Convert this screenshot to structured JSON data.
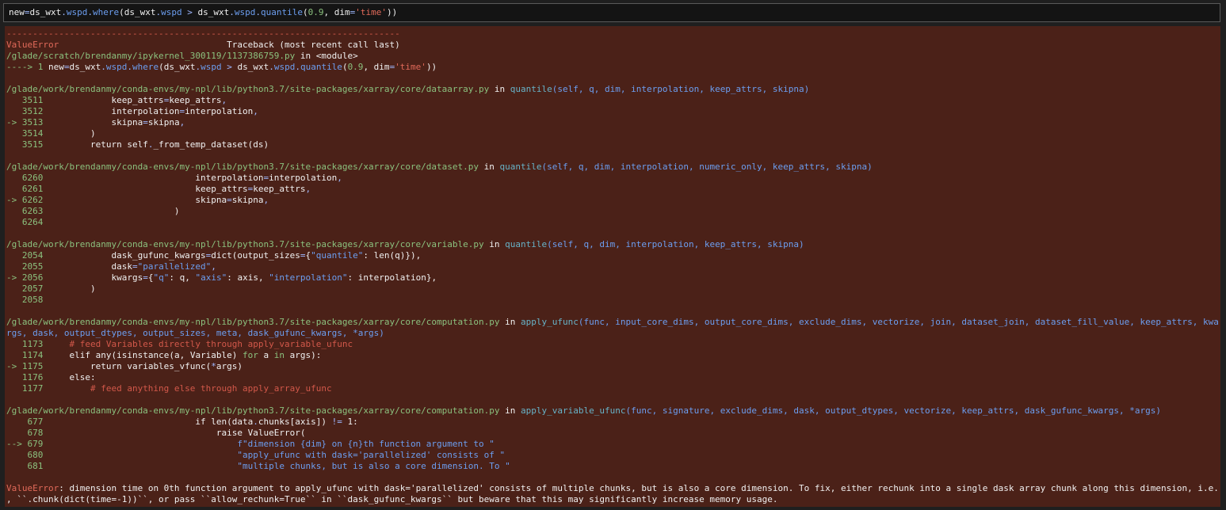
{
  "input_cell": {
    "segments": [
      {
        "t": "new",
        "c": "c-w"
      },
      {
        "t": "=",
        "c": "c-op"
      },
      {
        "t": "ds_wxt",
        "c": "c-w"
      },
      {
        "t": ".",
        "c": "c-op"
      },
      {
        "t": "wspd",
        "c": "c-bl"
      },
      {
        "t": ".",
        "c": "c-op"
      },
      {
        "t": "where",
        "c": "c-bl"
      },
      {
        "t": "(ds_wxt",
        "c": "c-w"
      },
      {
        "t": ".",
        "c": "c-op"
      },
      {
        "t": "wspd ",
        "c": "c-bl"
      },
      {
        "t": ">",
        "c": "c-op"
      },
      {
        "t": " ds_wxt",
        "c": "c-w"
      },
      {
        "t": ".",
        "c": "c-op"
      },
      {
        "t": "wspd",
        "c": "c-bl"
      },
      {
        "t": ".",
        "c": "c-op"
      },
      {
        "t": "quantile",
        "c": "c-bl"
      },
      {
        "t": "(",
        "c": "c-w"
      },
      {
        "t": "0.9",
        "c": "c-grn"
      },
      {
        "t": ", dim",
        "c": "c-w"
      },
      {
        "t": "=",
        "c": "c-op"
      },
      {
        "t": "'time'",
        "c": "c-red"
      },
      {
        "t": "))",
        "c": "c-w"
      }
    ]
  },
  "output": {
    "lines": [
      {
        "segments": [
          {
            "t": "---------------------------------------------------------------------------",
            "c": "c-dash"
          }
        ]
      },
      {
        "segments": [
          {
            "t": "ValueError",
            "c": "c-red"
          },
          {
            "t": "                                Traceback (most recent call last)",
            "c": "c-w"
          }
        ]
      },
      {
        "segments": [
          {
            "t": "/glade/scratch/brendanmy/ipykernel_300119/1137386759.py",
            "c": "c-grn"
          },
          {
            "t": " in ",
            "c": "c-w"
          },
          {
            "t": "<module>",
            "c": "c-w"
          }
        ]
      },
      {
        "segments": [
          {
            "t": "----> 1 ",
            "c": "c-grn"
          },
          {
            "t": "new",
            "c": "c-w"
          },
          {
            "t": "=",
            "c": "c-op"
          },
          {
            "t": "ds_wxt",
            "c": "c-w"
          },
          {
            "t": ".",
            "c": "c-op"
          },
          {
            "t": "wspd",
            "c": "c-bl"
          },
          {
            "t": ".",
            "c": "c-op"
          },
          {
            "t": "where",
            "c": "c-bl"
          },
          {
            "t": "(ds_wxt",
            "c": "c-w"
          },
          {
            "t": ".",
            "c": "c-op"
          },
          {
            "t": "wspd ",
            "c": "c-bl"
          },
          {
            "t": ">",
            "c": "c-op"
          },
          {
            "t": " ds_wxt",
            "c": "c-w"
          },
          {
            "t": ".",
            "c": "c-op"
          },
          {
            "t": "wspd",
            "c": "c-bl"
          },
          {
            "t": ".",
            "c": "c-op"
          },
          {
            "t": "quantile",
            "c": "c-bl"
          },
          {
            "t": "(",
            "c": "c-w"
          },
          {
            "t": "0.9",
            "c": "c-grn"
          },
          {
            "t": ", dim",
            "c": "c-w"
          },
          {
            "t": "=",
            "c": "c-op"
          },
          {
            "t": "'time'",
            "c": "c-red"
          },
          {
            "t": "))",
            "c": "c-w"
          }
        ]
      },
      {
        "segments": []
      },
      {
        "segments": [
          {
            "t": "/glade/work/brendanmy/conda-envs/my-npl/lib/python3.7/site-packages/xarray/core/dataarray.py",
            "c": "c-grn"
          },
          {
            "t": " in ",
            "c": "c-w"
          },
          {
            "t": "quantile",
            "c": "c-cy"
          },
          {
            "t": "(self, q, dim, interpolation, keep_attrs, skipna)",
            "c": "c-bl"
          }
        ]
      },
      {
        "segments": [
          {
            "t": "   3511",
            "c": "c-grn"
          },
          {
            "t": "             keep_attrs",
            "c": "c-w"
          },
          {
            "t": "=",
            "c": "c-op"
          },
          {
            "t": "keep_attrs",
            "c": "c-w"
          },
          {
            "t": ",",
            "c": "c-op"
          }
        ]
      },
      {
        "segments": [
          {
            "t": "   3512",
            "c": "c-grn"
          },
          {
            "t": "             interpolation",
            "c": "c-w"
          },
          {
            "t": "=",
            "c": "c-op"
          },
          {
            "t": "interpolation",
            "c": "c-w"
          },
          {
            "t": ",",
            "c": "c-op"
          }
        ]
      },
      {
        "segments": [
          {
            "t": "-> 3513",
            "c": "c-grn"
          },
          {
            "t": "             skipna",
            "c": "c-w"
          },
          {
            "t": "=",
            "c": "c-op"
          },
          {
            "t": "skipna",
            "c": "c-w"
          },
          {
            "t": ",",
            "c": "c-op"
          }
        ]
      },
      {
        "segments": [
          {
            "t": "   3514",
            "c": "c-grn"
          },
          {
            "t": "         )",
            "c": "c-w"
          }
        ]
      },
      {
        "segments": [
          {
            "t": "   3515",
            "c": "c-grn"
          },
          {
            "t": "         return",
            "c": "c-w"
          },
          {
            "t": " self",
            "c": "c-w"
          },
          {
            "t": ".",
            "c": "c-op"
          },
          {
            "t": "_from_temp_dataset",
            "c": "c-w"
          },
          {
            "t": "(ds)",
            "c": "c-w"
          }
        ]
      },
      {
        "segments": []
      },
      {
        "segments": [
          {
            "t": "/glade/work/brendanmy/conda-envs/my-npl/lib/python3.7/site-packages/xarray/core/dataset.py",
            "c": "c-grn"
          },
          {
            "t": " in ",
            "c": "c-w"
          },
          {
            "t": "quantile",
            "c": "c-cy"
          },
          {
            "t": "(self, q, dim, interpolation, numeric_only, keep_attrs, skipna)",
            "c": "c-bl"
          }
        ]
      },
      {
        "segments": [
          {
            "t": "   6260",
            "c": "c-grn"
          },
          {
            "t": "                             interpolation",
            "c": "c-w"
          },
          {
            "t": "=",
            "c": "c-op"
          },
          {
            "t": "interpolation",
            "c": "c-w"
          },
          {
            "t": ",",
            "c": "c-op"
          }
        ]
      },
      {
        "segments": [
          {
            "t": "   6261",
            "c": "c-grn"
          },
          {
            "t": "                             keep_attrs",
            "c": "c-w"
          },
          {
            "t": "=",
            "c": "c-op"
          },
          {
            "t": "keep_attrs",
            "c": "c-w"
          },
          {
            "t": ",",
            "c": "c-op"
          }
        ]
      },
      {
        "segments": [
          {
            "t": "-> 6262",
            "c": "c-grn"
          },
          {
            "t": "                             skipna",
            "c": "c-w"
          },
          {
            "t": "=",
            "c": "c-op"
          },
          {
            "t": "skipna",
            "c": "c-w"
          },
          {
            "t": ",",
            "c": "c-op"
          }
        ]
      },
      {
        "segments": [
          {
            "t": "   6263",
            "c": "c-grn"
          },
          {
            "t": "                         )",
            "c": "c-w"
          }
        ]
      },
      {
        "segments": [
          {
            "t": "   6264",
            "c": "c-grn"
          }
        ]
      },
      {
        "segments": []
      },
      {
        "segments": [
          {
            "t": "/glade/work/brendanmy/conda-envs/my-npl/lib/python3.7/site-packages/xarray/core/variable.py",
            "c": "c-grn"
          },
          {
            "t": " in ",
            "c": "c-w"
          },
          {
            "t": "quantile",
            "c": "c-cy"
          },
          {
            "t": "(self, q, dim, interpolation, keep_attrs, skipna)",
            "c": "c-bl"
          }
        ]
      },
      {
        "segments": [
          {
            "t": "   2054",
            "c": "c-grn"
          },
          {
            "t": "             dask_gufunc_kwargs",
            "c": "c-w"
          },
          {
            "t": "=",
            "c": "c-op"
          },
          {
            "t": "dict",
            "c": "c-w"
          },
          {
            "t": "(output_sizes",
            "c": "c-w"
          },
          {
            "t": "=",
            "c": "c-op"
          },
          {
            "t": "{",
            "c": "c-w"
          },
          {
            "t": "\"quantile\"",
            "c": "c-bl"
          },
          {
            "t": ": len(q)}),",
            "c": "c-w"
          }
        ]
      },
      {
        "segments": [
          {
            "t": "   2055",
            "c": "c-grn"
          },
          {
            "t": "             dask",
            "c": "c-w"
          },
          {
            "t": "=",
            "c": "c-op"
          },
          {
            "t": "\"parallelized\"",
            "c": "c-bl"
          },
          {
            "t": ",",
            "c": "c-op"
          }
        ]
      },
      {
        "segments": [
          {
            "t": "-> 2056",
            "c": "c-grn"
          },
          {
            "t": "             kwargs",
            "c": "c-w"
          },
          {
            "t": "=",
            "c": "c-op"
          },
          {
            "t": "{",
            "c": "c-w"
          },
          {
            "t": "\"q\"",
            "c": "c-bl"
          },
          {
            "t": ": q, ",
            "c": "c-w"
          },
          {
            "t": "\"axis\"",
            "c": "c-bl"
          },
          {
            "t": ": axis, ",
            "c": "c-w"
          },
          {
            "t": "\"interpolation\"",
            "c": "c-bl"
          },
          {
            "t": ": interpolation},",
            "c": "c-w"
          }
        ]
      },
      {
        "segments": [
          {
            "t": "   2057",
            "c": "c-grn"
          },
          {
            "t": "         )",
            "c": "c-w"
          }
        ]
      },
      {
        "segments": [
          {
            "t": "   2058",
            "c": "c-grn"
          }
        ]
      },
      {
        "segments": []
      },
      {
        "segments": [
          {
            "t": "/glade/work/brendanmy/conda-envs/my-npl/lib/python3.7/site-packages/xarray/core/computation.py",
            "c": "c-grn"
          },
          {
            "t": " in ",
            "c": "c-w"
          },
          {
            "t": "apply_ufunc",
            "c": "c-cy"
          },
          {
            "t": "(func, input_core_dims, output_core_dims, exclude_dims, vectorize, join, dataset_join, dataset_fill_value, keep_attrs, kwa",
            "c": "c-bl"
          }
        ]
      },
      {
        "segments": [
          {
            "t": "rgs, dask, output_dtypes, output_sizes, meta, dask_gufunc_kwargs, *args)",
            "c": "c-bl"
          }
        ]
      },
      {
        "segments": [
          {
            "t": "   1173",
            "c": "c-grn"
          },
          {
            "t": "     # feed Variables directly through apply_variable_ufunc",
            "c": "c-com"
          }
        ]
      },
      {
        "segments": [
          {
            "t": "   1174",
            "c": "c-grn"
          },
          {
            "t": "     elif",
            "c": "c-w"
          },
          {
            "t": " any",
            "c": "c-w"
          },
          {
            "t": "(",
            "c": "c-w"
          },
          {
            "t": "isinstance",
            "c": "c-w"
          },
          {
            "t": "(a, Variable)",
            "c": "c-w"
          },
          {
            "t": " for",
            "c": "c-grn"
          },
          {
            "t": " a ",
            "c": "c-w"
          },
          {
            "t": "in",
            "c": "c-grn"
          },
          {
            "t": " args):",
            "c": "c-w"
          }
        ]
      },
      {
        "segments": [
          {
            "t": "-> 1175",
            "c": "c-grn"
          },
          {
            "t": "         return",
            "c": "c-w"
          },
          {
            "t": " variables_vfunc",
            "c": "c-w"
          },
          {
            "t": "(",
            "c": "c-w"
          },
          {
            "t": "*",
            "c": "c-op"
          },
          {
            "t": "args)",
            "c": "c-w"
          }
        ]
      },
      {
        "segments": [
          {
            "t": "   1176",
            "c": "c-grn"
          },
          {
            "t": "     else:",
            "c": "c-w"
          }
        ]
      },
      {
        "segments": [
          {
            "t": "   1177",
            "c": "c-grn"
          },
          {
            "t": "         # feed anything else through apply_array_ufunc",
            "c": "c-com"
          }
        ]
      },
      {
        "segments": []
      },
      {
        "segments": [
          {
            "t": "/glade/work/brendanmy/conda-envs/my-npl/lib/python3.7/site-packages/xarray/core/computation.py",
            "c": "c-grn"
          },
          {
            "t": " in ",
            "c": "c-w"
          },
          {
            "t": "apply_variable_ufunc",
            "c": "c-cy"
          },
          {
            "t": "(func, signature, exclude_dims, dask, output_dtypes, vectorize, keep_attrs, dask_gufunc_kwargs, *args)",
            "c": "c-bl"
          }
        ]
      },
      {
        "segments": [
          {
            "t": "    677",
            "c": "c-grn"
          },
          {
            "t": "                             if",
            "c": "c-w"
          },
          {
            "t": " len",
            "c": "c-w"
          },
          {
            "t": "(data",
            "c": "c-w"
          },
          {
            "t": ".",
            "c": "c-op"
          },
          {
            "t": "chunks[axis]) ",
            "c": "c-w"
          },
          {
            "t": "!=",
            "c": "c-op"
          },
          {
            "t": " 1",
            "c": "c-w"
          },
          {
            "t": ":",
            "c": "c-w"
          }
        ]
      },
      {
        "segments": [
          {
            "t": "    678",
            "c": "c-grn"
          },
          {
            "t": "                                 raise",
            "c": "c-w"
          },
          {
            "t": " ValueError(",
            "c": "c-w"
          }
        ]
      },
      {
        "segments": [
          {
            "t": "--> 679",
            "c": "c-grn"
          },
          {
            "t": "                                     f\"dimension {dim} on {n}th function argument to \"",
            "c": "c-bl"
          }
        ]
      },
      {
        "segments": [
          {
            "t": "    680",
            "c": "c-grn"
          },
          {
            "t": "                                     \"apply_ufunc with dask='parallelized' consists of \"",
            "c": "c-bl"
          }
        ]
      },
      {
        "segments": [
          {
            "t": "    681",
            "c": "c-grn"
          },
          {
            "t": "                                     \"multiple chunks, but is also a core dimension. To \"",
            "c": "c-bl"
          }
        ]
      },
      {
        "segments": []
      },
      {
        "segments": [
          {
            "t": "ValueError",
            "c": "c-red"
          },
          {
            "t": ": dimension time on 0th function argument to apply_ufunc with dask='parallelized' consists of multiple chunks, but is also a core dimension. To fix, either rechunk into a single dask array chunk along this dimension, i.e.",
            "c": "c-w"
          }
        ]
      },
      {
        "segments": [
          {
            "t": ", ``.chunk(dict(time=-1))``, or pass ``allow_rechunk=True`` in ``dask_gufunc_kwargs`` but beware that this may significantly increase memory usage.",
            "c": "c-w"
          }
        ]
      }
    ]
  }
}
